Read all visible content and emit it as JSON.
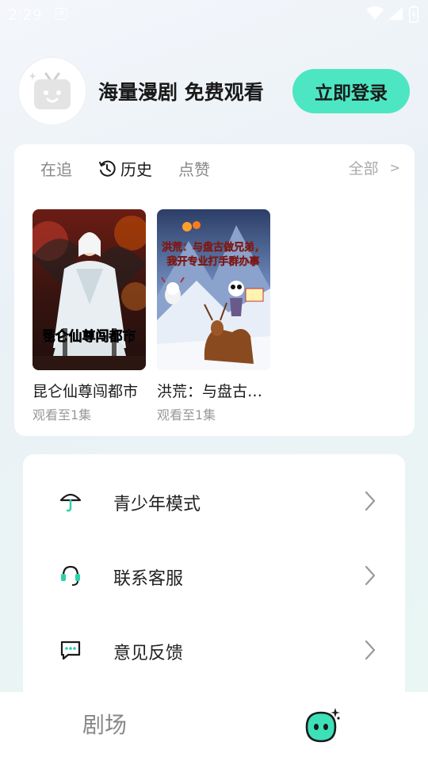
{
  "status_bar": {
    "time": "2:29",
    "notification_icon": "a-box-icon",
    "icons": [
      "wifi-icon",
      "signal-icon",
      "battery-icon"
    ]
  },
  "profile": {
    "avatar_icon": "tv-mascot-icon",
    "username": "海量漫剧 免费观看",
    "login_label": "立即登录",
    "accent_color": "#4de6c2"
  },
  "history": {
    "tabs": [
      {
        "label": "在追",
        "active": false
      },
      {
        "label": "历史",
        "active": true,
        "icon": "clock-icon"
      },
      {
        "label": "点赞",
        "active": false
      }
    ],
    "see_all_label": "全部",
    "see_all_chevron": ">",
    "items": [
      {
        "title": "昆仑仙尊闯都市",
        "progress": "观看至1集",
        "cover_text": "昆仑仙尊闯都市"
      },
      {
        "title": "洪荒：与盘古做兄弟，我开专业打手群办事",
        "progress": "观看至1集",
        "cover_text_1": "洪荒：与盘古做兄弟，",
        "cover_text_2": "我开专业打手群办事"
      }
    ]
  },
  "menu": {
    "items": [
      {
        "label": "青少年模式",
        "icon": "umbrella-icon"
      },
      {
        "label": "联系客服",
        "icon": "headset-icon"
      },
      {
        "label": "意见反馈",
        "icon": "message-icon"
      }
    ]
  },
  "bottom_nav": {
    "theater_label": "剧场",
    "mine_icon": "mascot-face-icon"
  }
}
